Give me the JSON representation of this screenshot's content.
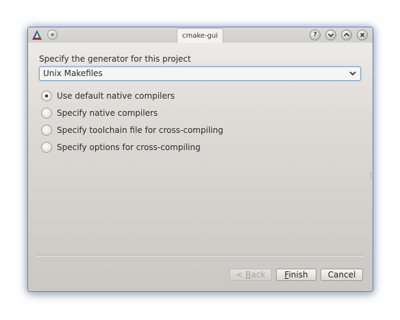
{
  "window": {
    "title": "cmake-gui",
    "buttons": {
      "help": "?",
      "minimize": "⌄",
      "maximize": "⌃",
      "close": "×"
    }
  },
  "page": {
    "generator_label": "Specify the generator for this project",
    "generator_value": "Unix Makefiles",
    "options": [
      {
        "label": "Use default native compilers",
        "checked": true
      },
      {
        "label": "Specify native compilers",
        "checked": false
      },
      {
        "label": "Specify toolchain file for cross-compiling",
        "checked": false
      },
      {
        "label": "Specify options for cross-compiling",
        "checked": false
      }
    ]
  },
  "footer": {
    "back": {
      "prefix": "< ",
      "mnemonic": "B",
      "rest": "ack",
      "enabled": false
    },
    "finish": {
      "mnemonic": "F",
      "rest": "inish"
    },
    "cancel": "Cancel"
  },
  "colors": {
    "focus_blue": "#7ba3cf",
    "window_border": "#5b87b2"
  }
}
